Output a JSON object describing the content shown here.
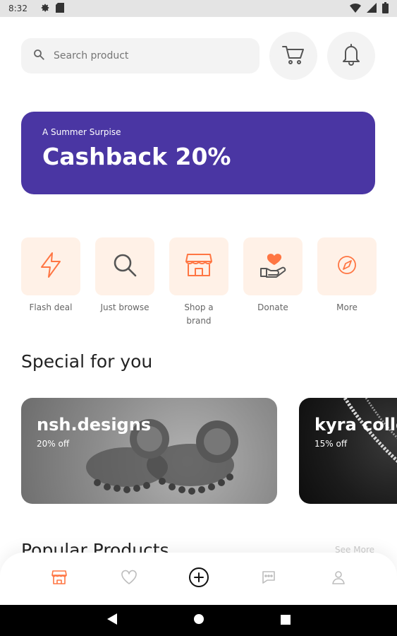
{
  "status": {
    "time": "8:32",
    "left_icons": [
      "settings-icon",
      "sd-card-icon"
    ],
    "right_icons": [
      "wifi-icon",
      "signal-icon",
      "battery-icon"
    ]
  },
  "search": {
    "placeholder": "Search product"
  },
  "topbar_icons": [
    "cart-icon",
    "bell-icon"
  ],
  "banner": {
    "subtitle": "A Summer Surpise",
    "title": "Cashback 20%",
    "color": "#4a36a3"
  },
  "categories": [
    {
      "label": "Flash deal",
      "icon": "flash-icon"
    },
    {
      "label": "Just browse",
      "icon": "search-icon"
    },
    {
      "label": "Shop a\nbrand",
      "icon": "store-icon"
    },
    {
      "label": "Donate",
      "icon": "donate-icon"
    },
    {
      "label": "More",
      "icon": "compass-icon"
    }
  ],
  "special": {
    "title": "Special for you",
    "cards": [
      {
        "name": "nsh.designs",
        "discount": "20% off"
      },
      {
        "name": "kyra colle",
        "discount": "15% off"
      }
    ]
  },
  "popular": {
    "title": "Popular Products",
    "see_more": "See More"
  },
  "bottom_nav": {
    "items": [
      "shop-icon",
      "heart-icon",
      "add-icon",
      "chat-icon",
      "profile-icon"
    ],
    "active_color": "#ff7643"
  },
  "accent": "#ff7643"
}
